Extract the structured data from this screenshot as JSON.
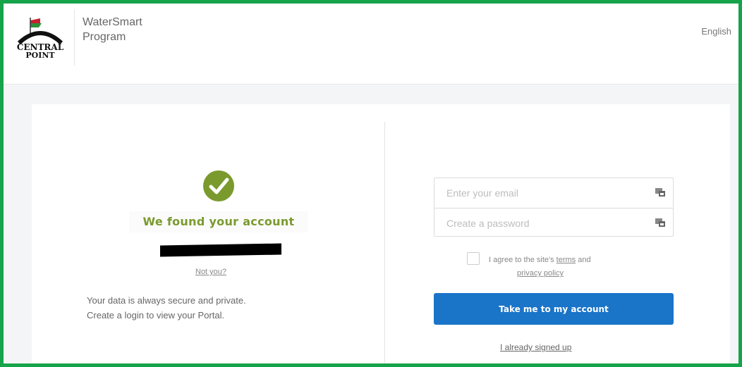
{
  "header": {
    "logo_line1": "CENTRAL",
    "logo_line2": "POINT",
    "program_line1": "WaterSmart",
    "program_line2": "Program",
    "language": "English"
  },
  "left": {
    "check_icon": "check-circle-icon",
    "found_title": "We found your account",
    "not_you": "Not you?",
    "secure_line1": "Your data is always secure and private.",
    "secure_line2": "Create a login to view your Portal."
  },
  "form": {
    "email_placeholder": "Enter your email",
    "password_placeholder": "Create a password",
    "field_icon": "password-manager-icon",
    "agree_prefix": "I agree to the site's ",
    "terms_link": "terms",
    "agree_and": " and",
    "privacy_link": "privacy policy",
    "submit_label": "Take me to my account",
    "already_link": "I already signed up"
  },
  "colors": {
    "frame_border": "#17a34a",
    "check_green": "#7a9a2e",
    "primary_blue": "#1a74c8",
    "logo_red": "#c8202f",
    "logo_green": "#2f8f3a"
  }
}
